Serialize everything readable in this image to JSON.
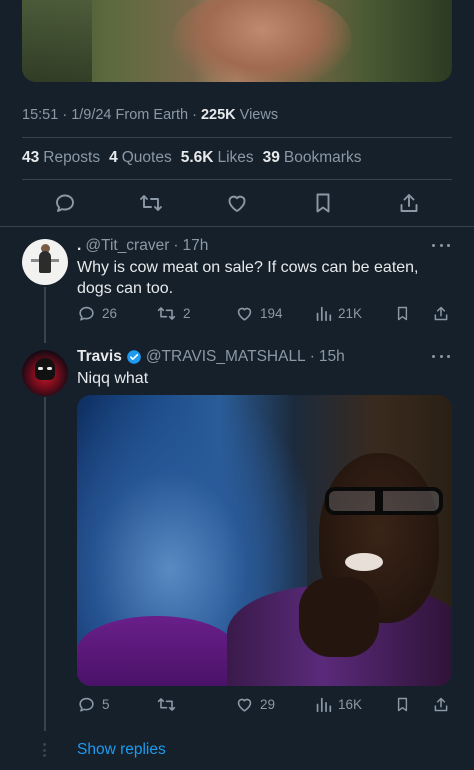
{
  "post": {
    "time": "15:51",
    "date": "1/9/24",
    "source": "From Earth",
    "views_count": "225K",
    "views_label": "Views",
    "stats": [
      {
        "count": "43",
        "label": "Reposts"
      },
      {
        "count": "4",
        "label": "Quotes"
      },
      {
        "count": "5.6K",
        "label": "Likes"
      },
      {
        "count": "39",
        "label": "Bookmarks"
      }
    ]
  },
  "replies": [
    {
      "display_name": ".",
      "handle": "@Tit_craver",
      "age": "17h",
      "text": "Why is cow meat on sale? If cows can be eaten, dogs can too.",
      "reply_count": "26",
      "repost_count": "2",
      "like_count": "194",
      "view_count": "21K"
    },
    {
      "display_name": "Travis",
      "handle": "@TRAVIS_MATSHALL",
      "age": "15h",
      "text": "Niqq what",
      "reply_count": "5",
      "repost_count": "",
      "like_count": "29",
      "view_count": "16K"
    }
  ],
  "show_replies": "Show replies",
  "colors": {
    "background": "#15202b",
    "accent": "#1d9bf0",
    "muted": "#8b98a5",
    "text": "#e7e9ea",
    "divider": "#38444d"
  },
  "icons": [
    "reply-icon",
    "repost-icon",
    "like-icon",
    "bookmark-icon",
    "share-icon",
    "views-icon",
    "more-icon",
    "verified-icon"
  ]
}
